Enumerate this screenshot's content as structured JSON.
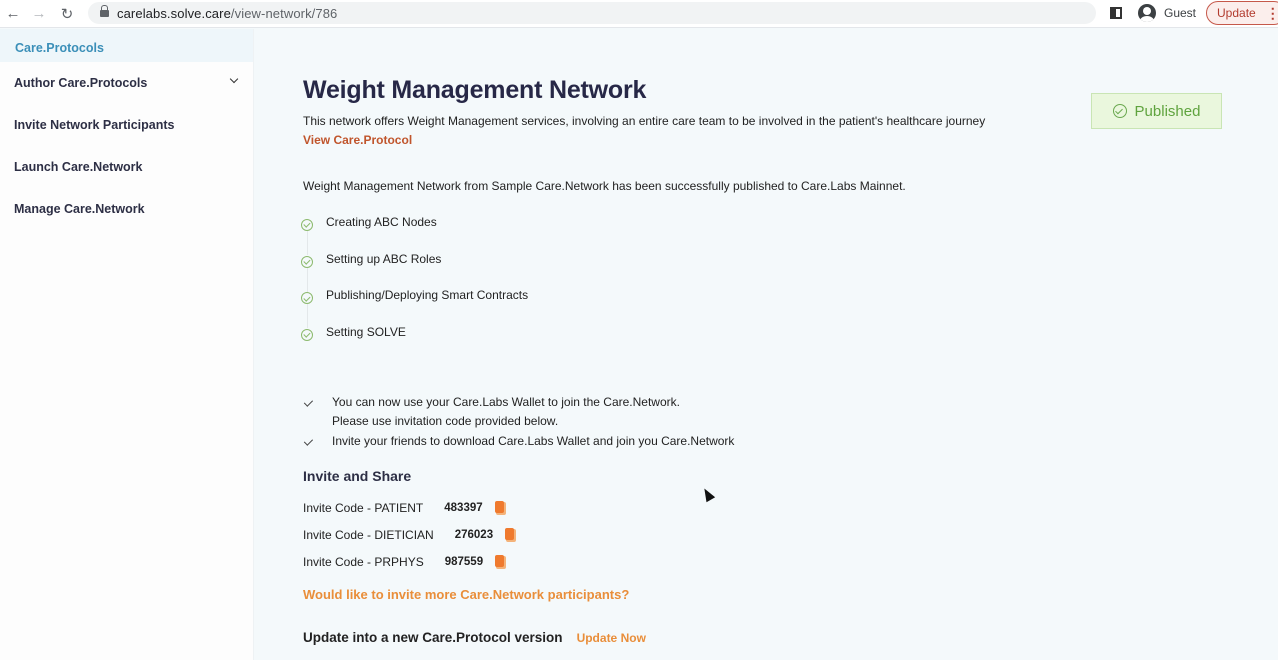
{
  "browser": {
    "url_host": "carelabs.solve.care",
    "url_path": "/view-network/786",
    "profile_label": "Guest",
    "update_label": "Update"
  },
  "sidebar": {
    "header": "Care.Protocols",
    "items": [
      {
        "label": "Author Care.Protocols",
        "expandable": true
      },
      {
        "label": "Invite Network Participants"
      },
      {
        "label": "Launch Care.Network"
      },
      {
        "label": "Manage Care.Network"
      }
    ]
  },
  "main": {
    "title": "Weight Management Network",
    "description": "This network offers Weight Management services, involving an entire care team to be involved in the patient's healthcare journey",
    "view_link": "View Care.Protocol",
    "status_badge": "Published",
    "success_message": "Weight Management Network from Sample Care.Network has been successfully published to Care.Labs Mainnet.",
    "steps": [
      {
        "label": "Creating ABC Nodes",
        "status": "done"
      },
      {
        "label": "Setting up ABC Roles",
        "status": "done"
      },
      {
        "label": "Publishing/Deploying Smart Contracts",
        "status": "done"
      },
      {
        "label": "Setting SOLVE",
        "status": "done"
      }
    ],
    "notes": [
      {
        "line1": "You can now use your Care.Labs Wallet to join the Care.Network.",
        "line2": "Please use invitation code provided below."
      },
      {
        "line1": "Invite your friends to download Care.Labs Wallet and join you Care.Network"
      }
    ],
    "invite_heading": "Invite and Share",
    "invite_codes": [
      {
        "label": "Invite Code - PATIENT",
        "code": "483397"
      },
      {
        "label": "Invite Code - DIETICIAN",
        "code": "276023"
      },
      {
        "label": "Invite Code - PRPHYS",
        "code": "987559"
      }
    ],
    "invite_more_link": "Would like to invite more Care.Network participants?",
    "update_text": "Update into a new Care.Protocol version",
    "update_now_link": "Update Now"
  },
  "colors": {
    "accent_orange": "#e98e3a",
    "link_red": "#c0552c",
    "success_green": "#5fa33e",
    "sidebar_header_blue": "#3b8fb8",
    "title_navy": "#272847"
  }
}
